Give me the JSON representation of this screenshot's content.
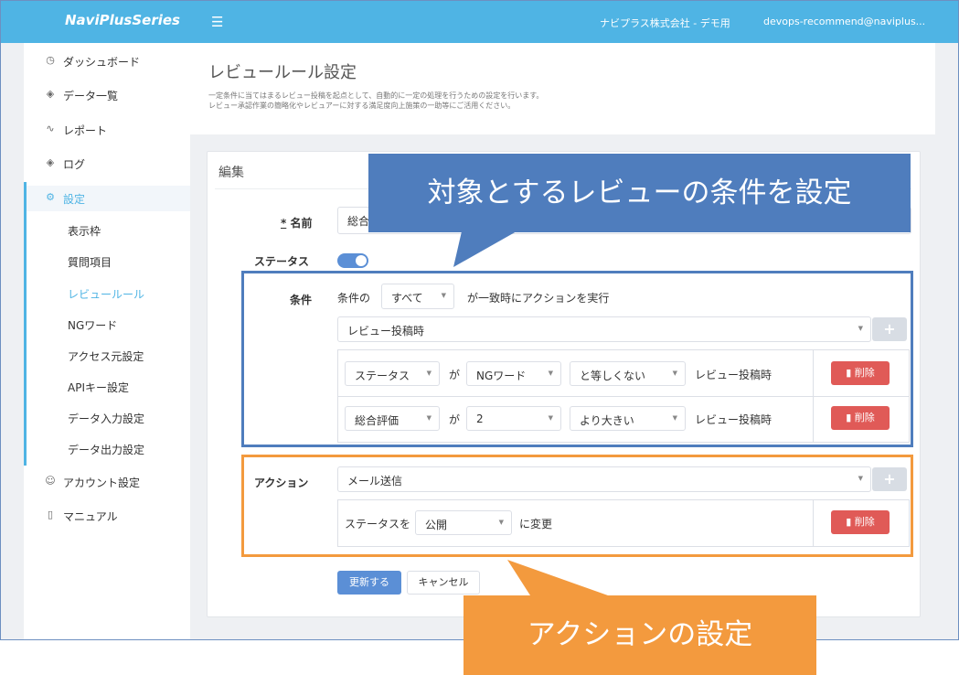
{
  "topbar": {
    "logo": "NaviPlusSeries",
    "menu_icon": "hamburger-icon",
    "company": "ナビプラス株式会社 - デモ用",
    "user": "devops-recommend@naviplus..."
  },
  "sidebar": {
    "items": [
      {
        "label": "ダッシュボード",
        "icon": "clock-icon"
      },
      {
        "label": "データ一覧",
        "icon": "layers-icon"
      },
      {
        "label": "レポート",
        "icon": "trend-icon"
      },
      {
        "label": "ログ",
        "icon": "layers-icon"
      },
      {
        "label": "設定",
        "icon": "gear-icon"
      },
      {
        "label": "アカウント設定",
        "icon": "user-icon"
      },
      {
        "label": "マニュアル",
        "icon": "book-icon"
      }
    ],
    "sub_items": [
      "表示枠",
      "質問項目",
      "レビュールール",
      "NGワード",
      "アクセス元設定",
      "APIキー設定",
      "データ入力設定",
      "データ出力設定"
    ]
  },
  "page": {
    "title": "レビュールール設定",
    "desc_line1": "一定条件に当てはまるレビュー投稿を起点として、自動的に一定の処理を行うための設定を行います。",
    "desc_line2": "レビュー承認作業の簡略化やレビュアーに対する満足度向上施策の一助等にご活用ください。"
  },
  "form": {
    "card_title": "編集",
    "name_label_mark": "*",
    "name_label": "名前",
    "name_value": "総合",
    "status_label": "ステータス",
    "status_on": true,
    "conditions_label": "条件",
    "cond_prefix": "条件の",
    "cond_match": "すべて",
    "cond_suffix": "が一致時にアクションを実行",
    "trigger": "レビュー投稿時",
    "plus": "+",
    "rows": [
      {
        "field": "ステータス",
        "ga": "が",
        "value": "NGワード",
        "op": "と等しくない",
        "tail": "レビュー投稿時",
        "delete": "削除"
      },
      {
        "field": "総合評価",
        "ga": "が",
        "value": "2",
        "op": "より大きい",
        "tail": "レビュー投稿時",
        "delete": "削除"
      }
    ],
    "action_label": "アクション",
    "action_value": "メール送信",
    "action_row": {
      "prefix": "ステータスを",
      "value": "公開",
      "suffix": "に変更",
      "delete": "削除"
    },
    "submit": "更新する",
    "cancel": "キャンセル"
  },
  "annotations": {
    "callout_conditions": "対象とするレビューの条件を設定",
    "callout_action": "アクションの設定",
    "colors": {
      "blue": "#4f7dbd",
      "orange": "#f39a3e",
      "accent": "#4fb4e4",
      "danger": "#e05a57"
    }
  }
}
